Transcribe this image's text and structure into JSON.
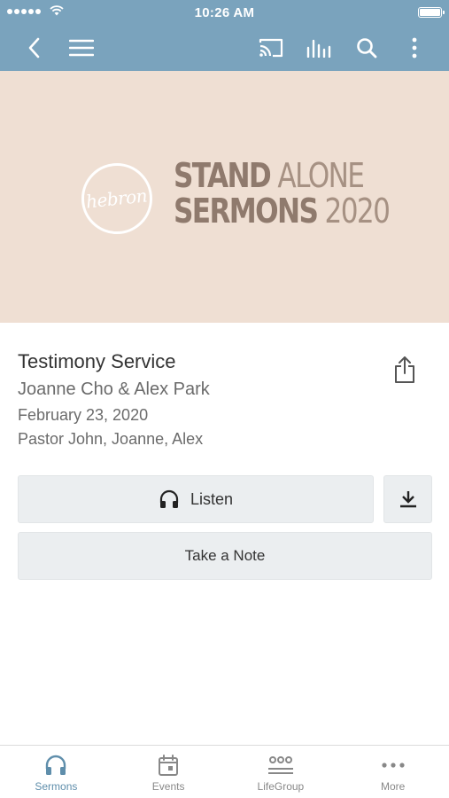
{
  "status_bar": {
    "time": "10:26 AM"
  },
  "nav": {
    "icons": [
      "back-icon",
      "menu-icon",
      "cast-icon",
      "audio-bars-icon",
      "search-icon",
      "more-vertical-icon"
    ],
    "color": "#7aa3bd"
  },
  "banner": {
    "logo_text": "hebron",
    "line1_bold": "STAND",
    "line1_light": "ALONE",
    "line2_bold": "SERMONS",
    "line2_light": "2020",
    "background": "#efdfd3"
  },
  "sermon": {
    "title": "Testimony Service",
    "speakers": "Joanne Cho & Alex Park",
    "date": "February 23, 2020",
    "people": "Pastor John, Joanne, Alex"
  },
  "actions": {
    "listen_label": "Listen",
    "note_label": "Take a Note"
  },
  "tabs": [
    {
      "label": "Sermons",
      "icon": "headphones-icon",
      "active": true
    },
    {
      "label": "Events",
      "icon": "calendar-icon",
      "active": false
    },
    {
      "label": "LifeGroup",
      "icon": "group-icon",
      "active": false
    },
    {
      "label": "More",
      "icon": "more-dots-icon",
      "active": false
    }
  ],
  "colors": {
    "accent": "#5f8eab",
    "button_bg": "#ebeef0"
  }
}
